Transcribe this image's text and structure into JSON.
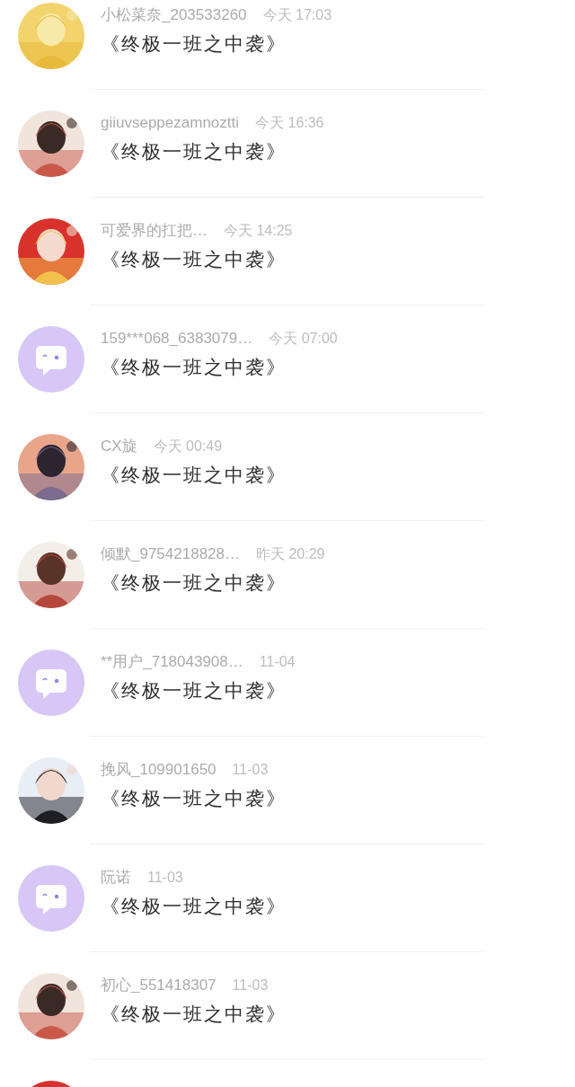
{
  "comments": [
    {
      "avatar": {
        "kind": "picture"
      },
      "user": "小松菜奈_203533260",
      "time": "今天 17:03",
      "text": "《终极一班之中袭》"
    },
    {
      "avatar": {
        "kind": "picture"
      },
      "user": "giiuvseppezamnoztti",
      "time": "今天 16:36",
      "text": "《终极一班之中袭》"
    },
    {
      "avatar": {
        "kind": "picture"
      },
      "user": "可爱界的扛把…",
      "time": "今天 14:25",
      "text": "《终极一班之中袭》"
    },
    {
      "avatar": {
        "kind": "default"
      },
      "user": "159***068_6383079…",
      "time": "今天 07:00",
      "text": "《终极一班之中袭》"
    },
    {
      "avatar": {
        "kind": "picture"
      },
      "user": "CX旋",
      "time": "今天 00:49",
      "text": "《终极一班之中袭》"
    },
    {
      "avatar": {
        "kind": "picture"
      },
      "user": "倾默_9754218828…",
      "time": "昨天 20:29",
      "text": "《终极一班之中袭》"
    },
    {
      "avatar": {
        "kind": "default"
      },
      "user": "**用户_718043908…",
      "time": "11-04",
      "text": "《终极一班之中袭》"
    },
    {
      "avatar": {
        "kind": "picture"
      },
      "user": "挽风_109901650",
      "time": "11-03",
      "text": "《终极一班之中袭》"
    },
    {
      "avatar": {
        "kind": "default"
      },
      "user": "阮诺",
      "time": "11-03",
      "text": "《终极一班之中袭》"
    },
    {
      "avatar": {
        "kind": "picture"
      },
      "user": "初心_551418307",
      "time": "11-03",
      "text": "《终极一班之中袭》"
    },
    {
      "avatar": {
        "kind": "picture"
      }
    }
  ]
}
